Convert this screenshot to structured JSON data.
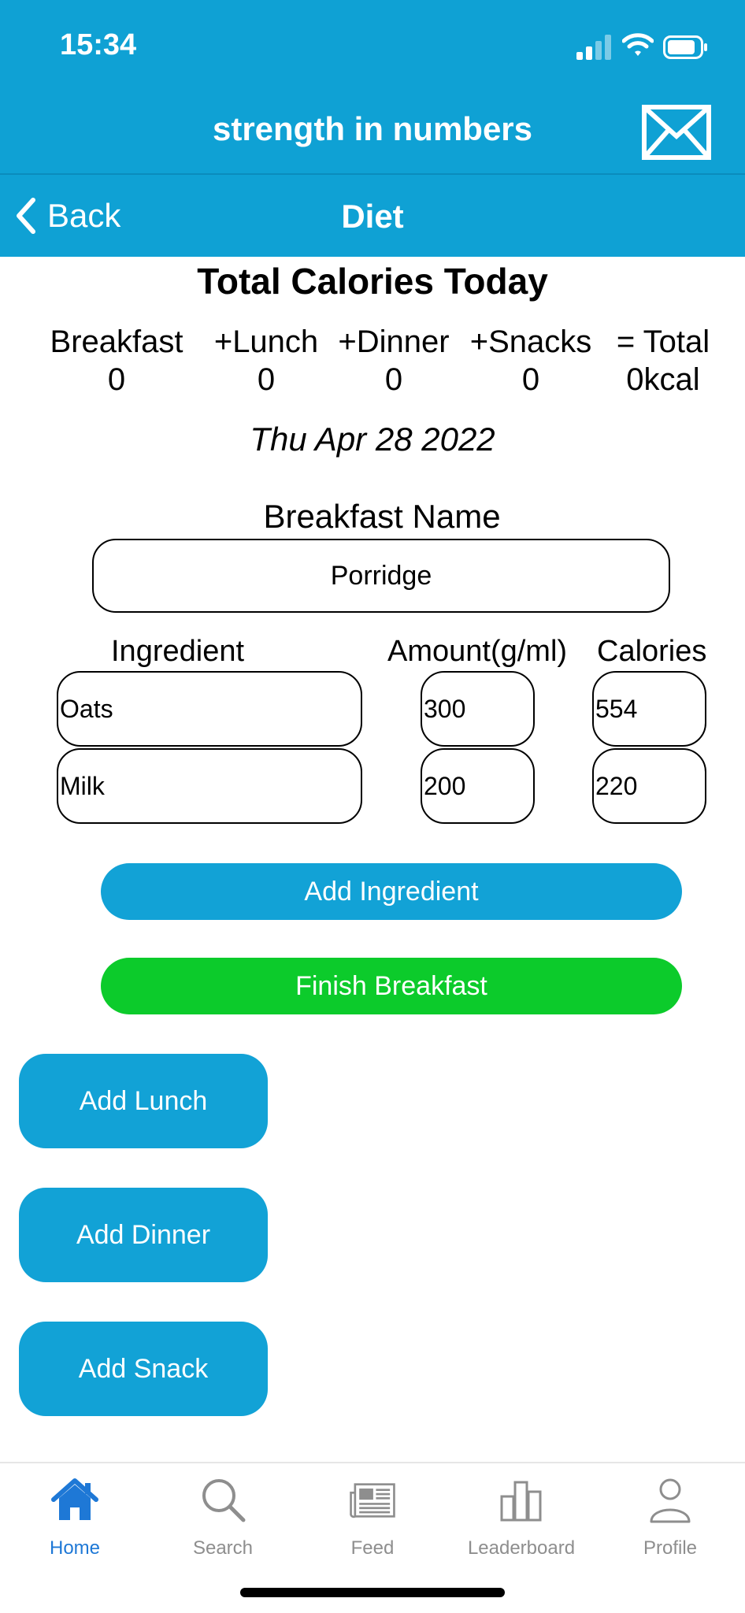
{
  "status_bar": {
    "time": "15:34"
  },
  "header": {
    "app_title": "strength in numbers",
    "back_label": "Back",
    "nav_title": "Diet",
    "brand_color": "#0fa1d4"
  },
  "summary": {
    "title": "Total Calories Today",
    "columns": [
      {
        "label": "Breakfast",
        "value": "0"
      },
      {
        "label": "+Lunch",
        "value": "0"
      },
      {
        "label": "+Dinner",
        "value": "0"
      },
      {
        "label": "+Snacks",
        "value": "0"
      },
      {
        "label": "= Total",
        "value": "0kcal"
      }
    ],
    "date": "Thu Apr 28 2022"
  },
  "meal": {
    "name_label": "Breakfast Name",
    "name_value": "Porridge",
    "headers": {
      "ingredient": "Ingredient",
      "amount": "Amount(g/ml)",
      "calories": "Calories"
    },
    "rows": [
      {
        "ingredient": "Oats",
        "amount": "300",
        "calories": "554"
      },
      {
        "ingredient": "Milk",
        "amount": "200",
        "calories": "220"
      }
    ],
    "add_ingredient_label": "Add Ingredient",
    "finish_label": "Finish Breakfast",
    "finish_color": "#0ccb2b"
  },
  "meal_buttons": {
    "lunch": "Add Lunch",
    "dinner": "Add Dinner",
    "snack": "Add Snack"
  },
  "tabbar": {
    "items": [
      {
        "label": "Home",
        "icon": "home-icon",
        "active": true
      },
      {
        "label": "Search",
        "icon": "search-icon",
        "active": false
      },
      {
        "label": "Feed",
        "icon": "newspaper-icon",
        "active": false
      },
      {
        "label": "Leaderboard",
        "icon": "bar-chart-icon",
        "active": false
      },
      {
        "label": "Profile",
        "icon": "person-icon",
        "active": false
      }
    ],
    "active_color": "#1e78d6",
    "inactive_color": "#8e8e8e"
  }
}
